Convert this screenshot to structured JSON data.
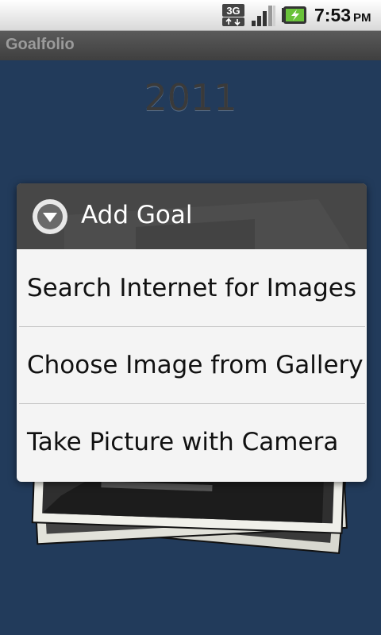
{
  "status_bar": {
    "network_icon": "3g-data-icon",
    "signal_icon": "signal-strength-icon",
    "battery_icon": "battery-charging-icon",
    "time": "7:53",
    "ampm": "PM"
  },
  "app": {
    "title": "Goalfolio"
  },
  "background": {
    "year": "2011"
  },
  "dialog": {
    "icon": "chevron-down-circle-icon",
    "title": "Add Goal",
    "items": [
      {
        "label": "Search Internet for Images"
      },
      {
        "label": "Choose Image from Gallery"
      },
      {
        "label": "Take Picture with Camera"
      }
    ]
  }
}
